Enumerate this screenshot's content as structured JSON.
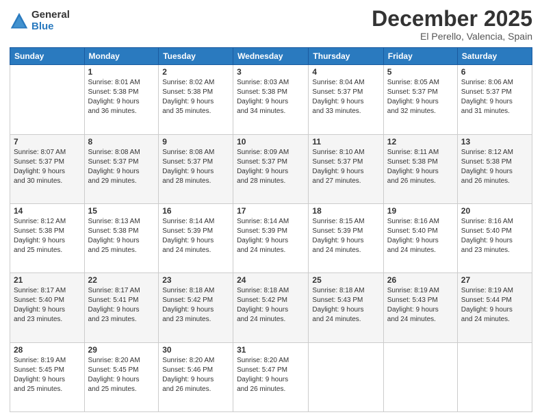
{
  "logo": {
    "general": "General",
    "blue": "Blue"
  },
  "header": {
    "title": "December 2025",
    "subtitle": "El Perello, Valencia, Spain"
  },
  "weekdays": [
    "Sunday",
    "Monday",
    "Tuesday",
    "Wednesday",
    "Thursday",
    "Friday",
    "Saturday"
  ],
  "weeks": [
    [
      {
        "day": "",
        "info": ""
      },
      {
        "day": "1",
        "info": "Sunrise: 8:01 AM\nSunset: 5:38 PM\nDaylight: 9 hours\nand 36 minutes."
      },
      {
        "day": "2",
        "info": "Sunrise: 8:02 AM\nSunset: 5:38 PM\nDaylight: 9 hours\nand 35 minutes."
      },
      {
        "day": "3",
        "info": "Sunrise: 8:03 AM\nSunset: 5:38 PM\nDaylight: 9 hours\nand 34 minutes."
      },
      {
        "day": "4",
        "info": "Sunrise: 8:04 AM\nSunset: 5:37 PM\nDaylight: 9 hours\nand 33 minutes."
      },
      {
        "day": "5",
        "info": "Sunrise: 8:05 AM\nSunset: 5:37 PM\nDaylight: 9 hours\nand 32 minutes."
      },
      {
        "day": "6",
        "info": "Sunrise: 8:06 AM\nSunset: 5:37 PM\nDaylight: 9 hours\nand 31 minutes."
      }
    ],
    [
      {
        "day": "7",
        "info": "Sunrise: 8:07 AM\nSunset: 5:37 PM\nDaylight: 9 hours\nand 30 minutes."
      },
      {
        "day": "8",
        "info": "Sunrise: 8:08 AM\nSunset: 5:37 PM\nDaylight: 9 hours\nand 29 minutes."
      },
      {
        "day": "9",
        "info": "Sunrise: 8:08 AM\nSunset: 5:37 PM\nDaylight: 9 hours\nand 28 minutes."
      },
      {
        "day": "10",
        "info": "Sunrise: 8:09 AM\nSunset: 5:37 PM\nDaylight: 9 hours\nand 28 minutes."
      },
      {
        "day": "11",
        "info": "Sunrise: 8:10 AM\nSunset: 5:37 PM\nDaylight: 9 hours\nand 27 minutes."
      },
      {
        "day": "12",
        "info": "Sunrise: 8:11 AM\nSunset: 5:38 PM\nDaylight: 9 hours\nand 26 minutes."
      },
      {
        "day": "13",
        "info": "Sunrise: 8:12 AM\nSunset: 5:38 PM\nDaylight: 9 hours\nand 26 minutes."
      }
    ],
    [
      {
        "day": "14",
        "info": "Sunrise: 8:12 AM\nSunset: 5:38 PM\nDaylight: 9 hours\nand 25 minutes."
      },
      {
        "day": "15",
        "info": "Sunrise: 8:13 AM\nSunset: 5:38 PM\nDaylight: 9 hours\nand 25 minutes."
      },
      {
        "day": "16",
        "info": "Sunrise: 8:14 AM\nSunset: 5:39 PM\nDaylight: 9 hours\nand 24 minutes."
      },
      {
        "day": "17",
        "info": "Sunrise: 8:14 AM\nSunset: 5:39 PM\nDaylight: 9 hours\nand 24 minutes."
      },
      {
        "day": "18",
        "info": "Sunrise: 8:15 AM\nSunset: 5:39 PM\nDaylight: 9 hours\nand 24 minutes."
      },
      {
        "day": "19",
        "info": "Sunrise: 8:16 AM\nSunset: 5:40 PM\nDaylight: 9 hours\nand 24 minutes."
      },
      {
        "day": "20",
        "info": "Sunrise: 8:16 AM\nSunset: 5:40 PM\nDaylight: 9 hours\nand 23 minutes."
      }
    ],
    [
      {
        "day": "21",
        "info": "Sunrise: 8:17 AM\nSunset: 5:40 PM\nDaylight: 9 hours\nand 23 minutes."
      },
      {
        "day": "22",
        "info": "Sunrise: 8:17 AM\nSunset: 5:41 PM\nDaylight: 9 hours\nand 23 minutes."
      },
      {
        "day": "23",
        "info": "Sunrise: 8:18 AM\nSunset: 5:42 PM\nDaylight: 9 hours\nand 23 minutes."
      },
      {
        "day": "24",
        "info": "Sunrise: 8:18 AM\nSunset: 5:42 PM\nDaylight: 9 hours\nand 24 minutes."
      },
      {
        "day": "25",
        "info": "Sunrise: 8:18 AM\nSunset: 5:43 PM\nDaylight: 9 hours\nand 24 minutes."
      },
      {
        "day": "26",
        "info": "Sunrise: 8:19 AM\nSunset: 5:43 PM\nDaylight: 9 hours\nand 24 minutes."
      },
      {
        "day": "27",
        "info": "Sunrise: 8:19 AM\nSunset: 5:44 PM\nDaylight: 9 hours\nand 24 minutes."
      }
    ],
    [
      {
        "day": "28",
        "info": "Sunrise: 8:19 AM\nSunset: 5:45 PM\nDaylight: 9 hours\nand 25 minutes."
      },
      {
        "day": "29",
        "info": "Sunrise: 8:20 AM\nSunset: 5:45 PM\nDaylight: 9 hours\nand 25 minutes."
      },
      {
        "day": "30",
        "info": "Sunrise: 8:20 AM\nSunset: 5:46 PM\nDaylight: 9 hours\nand 26 minutes."
      },
      {
        "day": "31",
        "info": "Sunrise: 8:20 AM\nSunset: 5:47 PM\nDaylight: 9 hours\nand 26 minutes."
      },
      {
        "day": "",
        "info": ""
      },
      {
        "day": "",
        "info": ""
      },
      {
        "day": "",
        "info": ""
      }
    ]
  ]
}
